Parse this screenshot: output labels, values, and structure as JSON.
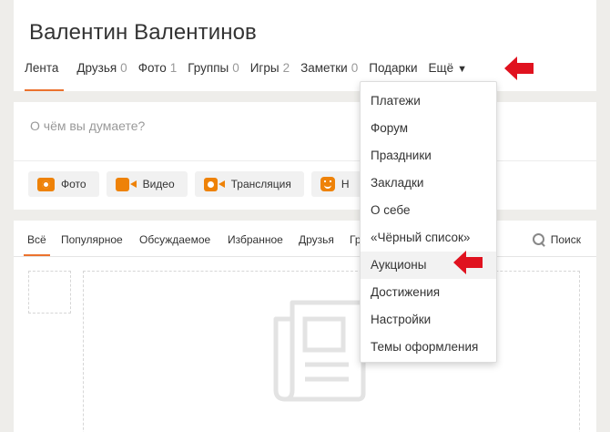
{
  "profile": {
    "name": "Валентин Валентинов",
    "nav": [
      {
        "label": "Лента",
        "count": ""
      },
      {
        "label": "Друзья",
        "count": "0"
      },
      {
        "label": "Фото",
        "count": "1"
      },
      {
        "label": "Группы",
        "count": "0"
      },
      {
        "label": "Игры",
        "count": "2"
      },
      {
        "label": "Заметки",
        "count": "0"
      },
      {
        "label": "Подарки",
        "count": ""
      },
      {
        "label": "Ещё",
        "count": ""
      }
    ],
    "more_caret": "▼"
  },
  "post": {
    "placeholder": "О чём вы думаете?",
    "actions": [
      "Фото",
      "Видео",
      "Трансляция",
      "Н"
    ]
  },
  "feed": {
    "tabs": [
      "Всё",
      "Популярное",
      "Обсуждаемое",
      "Избранное",
      "Друзья",
      "Гр"
    ],
    "search_label": "Поиск"
  },
  "dropdown": {
    "items": [
      "Платежи",
      "Форум",
      "Праздники",
      "Закладки",
      "О себе",
      "«Чёрный список»",
      "Аукционы",
      "Достижения",
      "Настройки",
      "Темы оформления"
    ],
    "highlighted_index": 6
  },
  "colors": {
    "accent": "#eb722e",
    "icon": "#ee8208",
    "annotation_arrow": "#e0121f"
  }
}
